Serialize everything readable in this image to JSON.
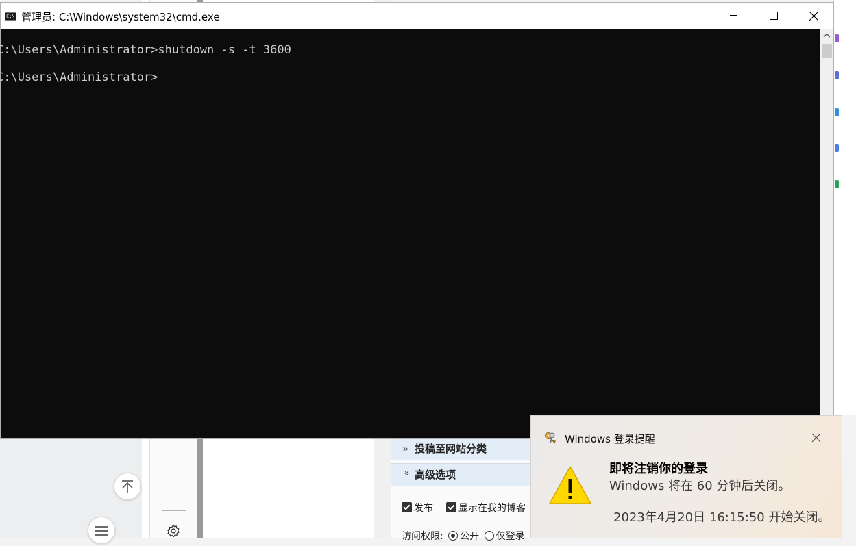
{
  "cmd_window": {
    "title": "管理员: C:\\Windows\\system32\\cmd.exe",
    "icon": "cmd-icon",
    "icon_text": "C:\\.",
    "console_lines": [
      "C:\\Users\\Administrator>shutdown -s -t 3600",
      "C:\\Users\\Administrator>"
    ],
    "controls": [
      "minimize",
      "maximize",
      "close"
    ]
  },
  "background_page": {
    "sections": {
      "category_label": "投稿至网站分类",
      "advanced_label": "高级选项"
    },
    "options": {
      "publish_label": "发布",
      "publish_checked": true,
      "show_in_blog_label": "显示在我的博客",
      "show_in_blog_checked": true,
      "access_label": "访问权限:",
      "access_public_label": "公开",
      "access_login_label": "仅登录",
      "access_selected": "公开"
    },
    "icons": [
      "back-to-top-icon",
      "list-icon",
      "gear-icon"
    ]
  },
  "toast": {
    "app_name": "Windows 登录提醒",
    "heading": "即将注销你的登录",
    "body": "Windows 将在 60 分钟后关闭。",
    "time": "2023年4月20日 16:15:50 开始关闭。",
    "icons": [
      "keys-icon",
      "warning-icon",
      "close-icon"
    ],
    "warning_color": "#ffd800"
  },
  "colors": {
    "console_bg": "#0c0c0c",
    "console_text": "#cccccc",
    "section_header_bg": "#e3edf7"
  }
}
